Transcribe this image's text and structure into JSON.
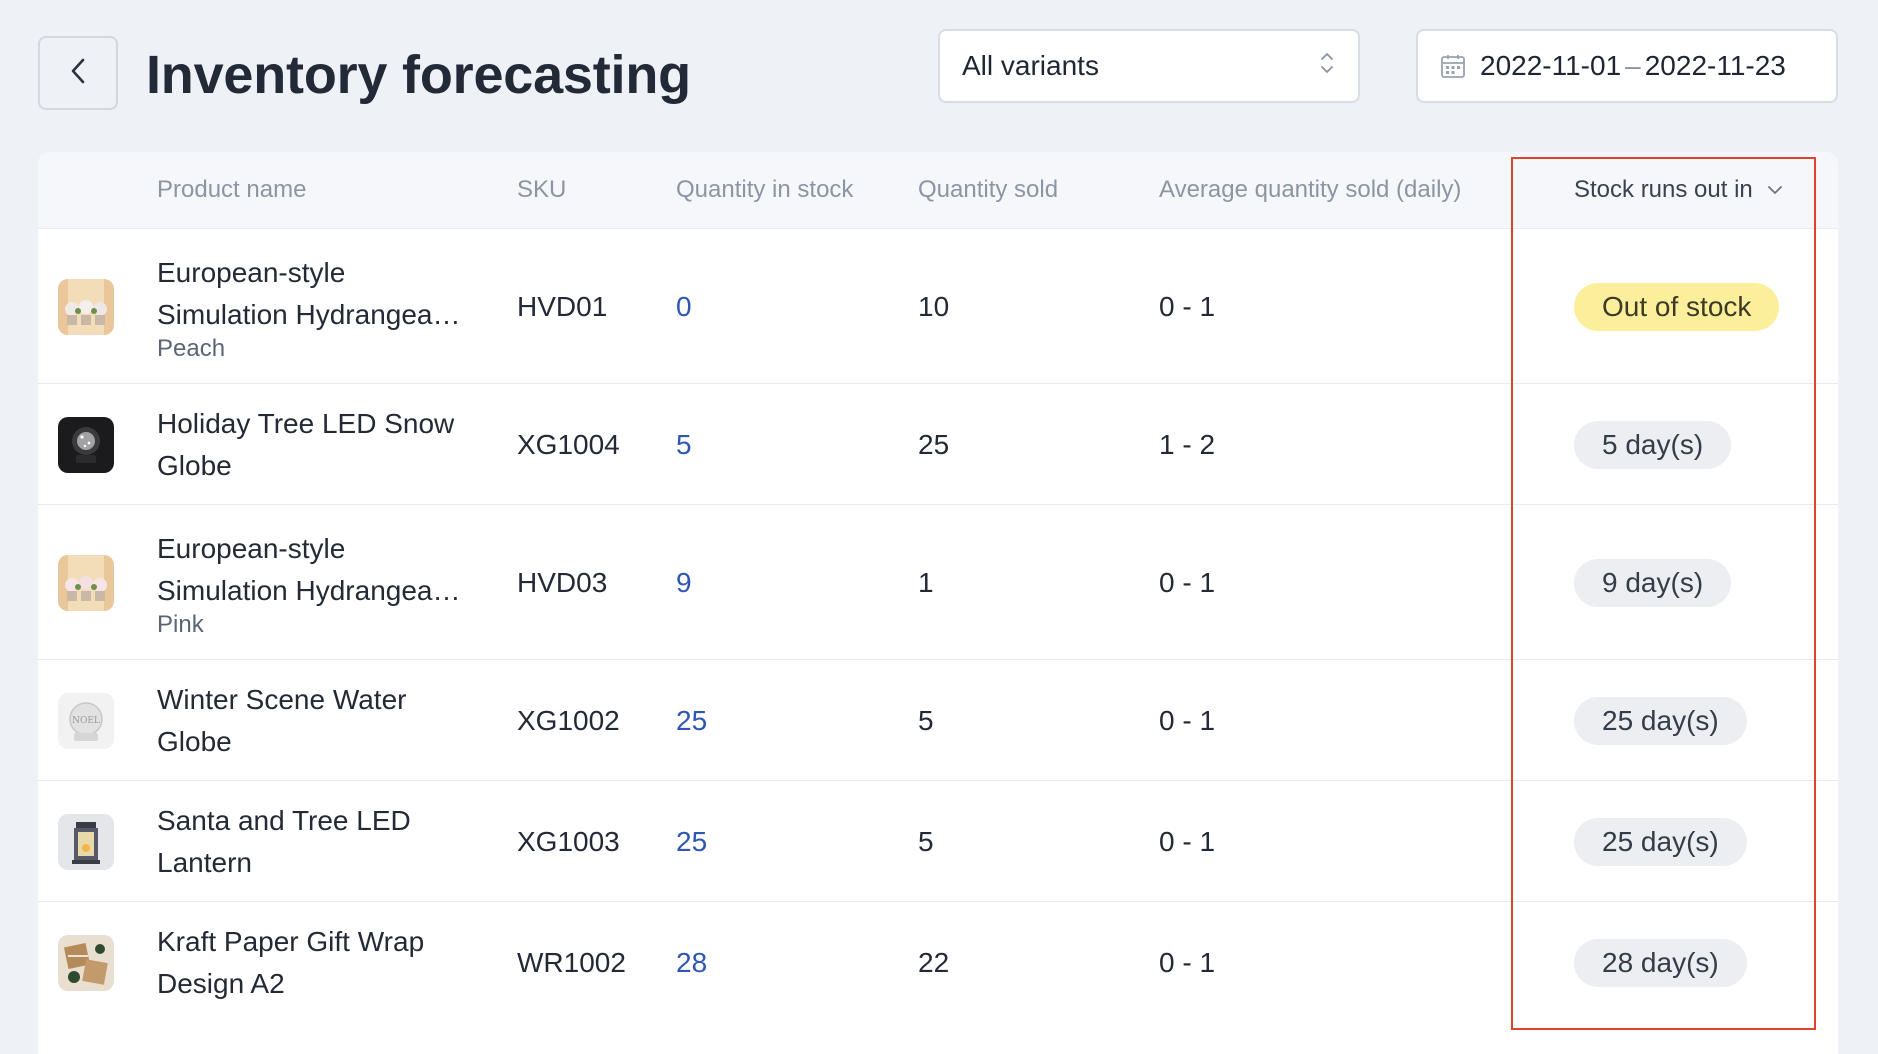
{
  "header": {
    "title": "Inventory forecasting",
    "variant_select": "All variants",
    "date_start": "2022-11-01",
    "date_sep": "–",
    "date_end": "2022-11-23"
  },
  "table": {
    "columns": {
      "product_name": "Product name",
      "sku": "SKU",
      "quantity_in_stock": "Quantity in stock",
      "quantity_sold": "Quantity sold",
      "avg_sold_daily": "Average quantity sold (daily)",
      "stock_runs_out": "Stock runs out in"
    },
    "rows": [
      {
        "name_line1": "European-style",
        "name_line2": "Simulation Hydrangea…",
        "variant": "Peach",
        "sku": "HVD01",
        "qty_stock": "0",
        "qty_sold": "10",
        "avg": "0 - 1",
        "runs_out": "Out of stock"
      },
      {
        "name_line1": "Holiday Tree LED Snow",
        "name_line2": "Globe",
        "variant": "",
        "sku": "XG1004",
        "qty_stock": "5",
        "qty_sold": "25",
        "avg": "1 - 2",
        "runs_out": "5 day(s)"
      },
      {
        "name_line1": "European-style",
        "name_line2": "Simulation Hydrangea…",
        "variant": "Pink",
        "sku": "HVD03",
        "qty_stock": "9",
        "qty_sold": "1",
        "avg": "0 - 1",
        "runs_out": "9 day(s)"
      },
      {
        "name_line1": "Winter Scene Water",
        "name_line2": "Globe",
        "variant": "",
        "sku": "XG1002",
        "qty_stock": "25",
        "qty_sold": "5",
        "avg": "0 - 1",
        "runs_out": "25 day(s)"
      },
      {
        "name_line1": "Santa and Tree LED",
        "name_line2": "Lantern",
        "variant": "",
        "sku": "XG1003",
        "qty_stock": "25",
        "qty_sold": "5",
        "avg": "0 - 1",
        "runs_out": "25 day(s)"
      },
      {
        "name_line1": "Kraft Paper Gift Wrap",
        "name_line2": "Design A2",
        "variant": "",
        "sku": "WR1002",
        "qty_stock": "28",
        "qty_sold": "22",
        "avg": "0 - 1",
        "runs_out": "28 day(s)"
      }
    ]
  },
  "colors": {
    "background": "#eef1f6",
    "link": "#2f56b3",
    "out_of_stock_badge": "#fbef9c",
    "days_badge": "#eceef2",
    "highlight": "#e0432c"
  },
  "icons": {
    "back": "chevron-left-icon",
    "select": "up-down-chevron-icon",
    "date": "calendar-icon",
    "sort": "chevron-down-icon"
  }
}
